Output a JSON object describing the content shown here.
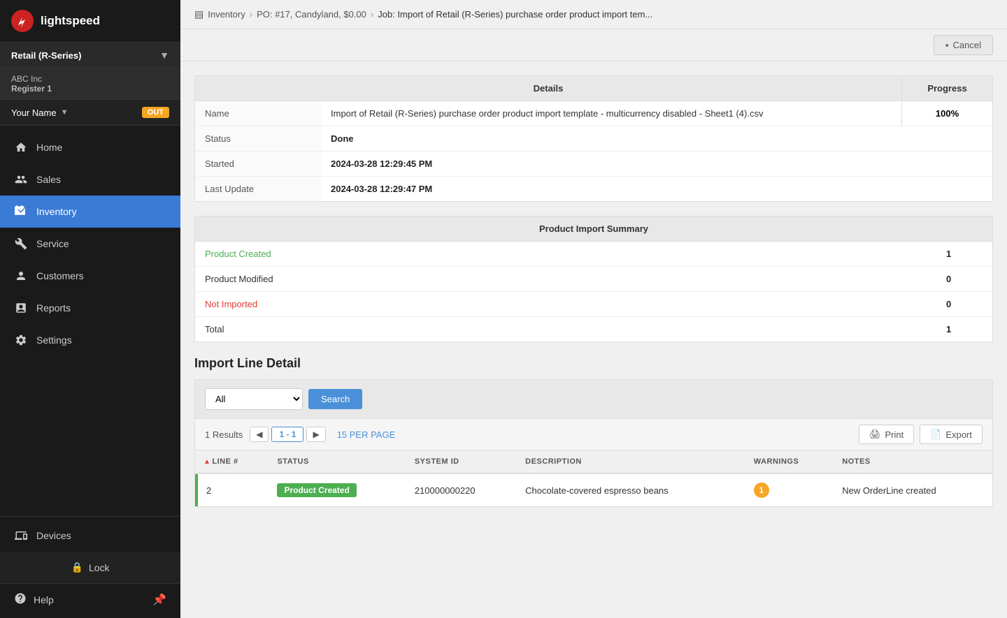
{
  "sidebar": {
    "logo_text": "lightspeed",
    "store_selector": {
      "label": "Retail (R-Series)",
      "dropdown_icon": "▼"
    },
    "company": "ABC Inc",
    "register": "Register 1",
    "user": {
      "name": "Your Name",
      "dropdown_icon": "▼",
      "out_label": "OUT"
    },
    "nav_items": [
      {
        "id": "home",
        "label": "Home",
        "icon": "home"
      },
      {
        "id": "sales",
        "label": "Sales",
        "icon": "sales"
      },
      {
        "id": "inventory",
        "label": "Inventory",
        "icon": "inventory",
        "active": true
      },
      {
        "id": "service",
        "label": "Service",
        "icon": "service"
      },
      {
        "id": "customers",
        "label": "Customers",
        "icon": "customers"
      },
      {
        "id": "reports",
        "label": "Reports",
        "icon": "reports"
      },
      {
        "id": "settings",
        "label": "Settings",
        "icon": "settings"
      }
    ],
    "devices_label": "Devices",
    "lock_label": "Lock",
    "help_label": "Help"
  },
  "breadcrumb": {
    "icon": "📋",
    "inventory_label": "Inventory",
    "po_label": "PO: #17, Candyland, $0.00",
    "job_label": "Job: Import of Retail (R-Series) purchase order product import tem..."
  },
  "toolbar": {
    "cancel_label": "Cancel"
  },
  "details": {
    "section_title": "Details",
    "progress_label": "Progress",
    "progress_value": "100%",
    "rows": [
      {
        "label": "Name",
        "value": "Import of Retail (R-Series) purchase order product import template - multicurrency disabled - Sheet1 (4).csv"
      },
      {
        "label": "Status",
        "value": "Done"
      },
      {
        "label": "Started",
        "value": "2024-03-28 12:29:45 PM"
      },
      {
        "label": "Last Update",
        "value": "2024-03-28 12:29:47 PM"
      }
    ]
  },
  "import_summary": {
    "section_title": "Product Import Summary",
    "rows": [
      {
        "label": "Product Created",
        "value": "1",
        "type": "green"
      },
      {
        "label": "Product Modified",
        "value": "0",
        "type": "normal"
      },
      {
        "label": "Not Imported",
        "value": "0",
        "type": "red"
      },
      {
        "label": "Total",
        "value": "1",
        "type": "normal"
      }
    ]
  },
  "import_line_detail": {
    "section_title": "Import Line Detail",
    "filter": {
      "options": [
        "All",
        "Product Created",
        "Product Modified",
        "Not Imported"
      ],
      "selected": "All",
      "search_label": "Search"
    },
    "results": {
      "count_label": "1 Results",
      "pagination": {
        "prev": "◀",
        "current": "1 - 1",
        "next": "▶"
      },
      "per_page_label": "15 PER PAGE",
      "print_label": "Print",
      "export_label": "Export"
    },
    "table": {
      "columns": [
        "LINE #",
        "STATUS",
        "SYSTEM ID",
        "DESCRIPTION",
        "WARNINGS",
        "NOTES"
      ],
      "rows": [
        {
          "line": "2",
          "status": "Product Created",
          "system_id": "210000000220",
          "description": "Chocolate-covered espresso beans",
          "warnings": "1",
          "notes": "New OrderLine created"
        }
      ]
    }
  }
}
